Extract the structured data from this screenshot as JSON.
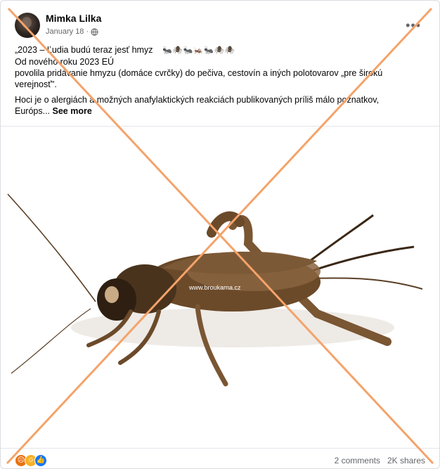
{
  "post": {
    "author": "Mimka Lilka",
    "date": "January 18",
    "date_separator": "·",
    "more_icon": "•••",
    "line1": "„2023 – Ľudia budú teraz jesť hmyz",
    "line1_emojis": "🐜🕷🐜🦗🐜🕷🕷",
    "line2": "Od nového roku 2023 EÚ",
    "line3": "povolila pridávanie hmyzu (domáce cvrčky) do pečiva, cestovín a iných polotovarov „pre širokú verejnosť\".",
    "line4": "Hoci je o alergiách a možných anafylaktických reakciách publikovaných príliš málo poznatkov, Európs...",
    "see_more": "See more",
    "image_watermark": "www.broukarna.cz"
  },
  "footer": {
    "reactions": [
      "angry",
      "haha",
      "like"
    ],
    "comments": "2 comments",
    "shares": "2K shares"
  },
  "colors": {
    "cross": "#f4a36a",
    "cricket_body": "#6b4a2a",
    "cricket_dark": "#2e1f12",
    "meta_text": "#65676b",
    "like": "#1877f2"
  }
}
